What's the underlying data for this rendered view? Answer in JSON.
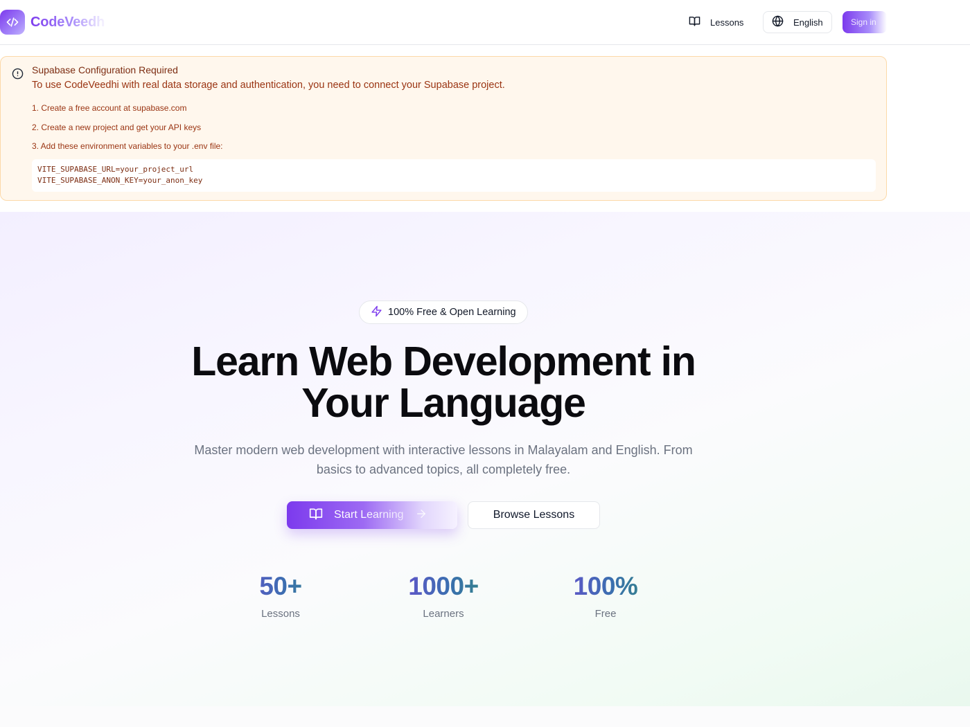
{
  "header": {
    "brand": "CodeVeedh",
    "nav_lessons": "Lessons",
    "language": "English",
    "sign_in": "Sign in"
  },
  "alert": {
    "title": "Supabase Configuration Required",
    "description": "To use CodeVeedhi with real data storage and authentication, you need to connect your Supabase project.",
    "steps": [
      "1. Create a free account at supabase.com",
      "2. Create a new project and get your API keys",
      "3. Add these environment variables to your .env file:"
    ],
    "code_lines": [
      "VITE_SUPABASE_URL=your_project_url",
      "VITE_SUPABASE_ANON_KEY=your_anon_key"
    ]
  },
  "hero": {
    "badge": "100% Free & Open Learning",
    "headline_line1": "Learn Web Development in",
    "headline_line2": "Your Language",
    "subtext_line1": "Master modern web development with interactive lessons in Malayalam and English. From",
    "subtext_line2": "basics to advanced topics, all completely free.",
    "primary_cta": "Start Learning",
    "secondary_cta": "Browse Lessons",
    "stats": [
      {
        "value": "50+",
        "label": "Lessons"
      },
      {
        "value": "1000+",
        "label": "Learners"
      },
      {
        "value": "100%",
        "label": "Free"
      }
    ]
  },
  "icons": {
    "brand": "code-icon",
    "lessons": "book-open-icon",
    "language": "globe-icon",
    "alert": "alert-circle-icon",
    "badge": "zap-icon",
    "cta_arrow": "arrow-right-icon"
  },
  "colors": {
    "accent": "#7c3aed",
    "alert_bg": "#fff7ed",
    "alert_text": "#9a3412"
  }
}
